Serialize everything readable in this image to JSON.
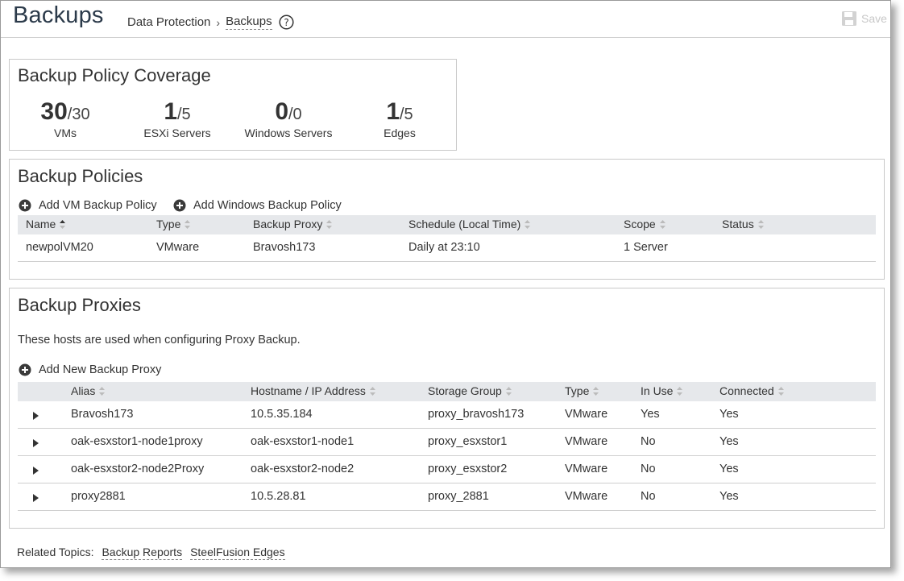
{
  "header": {
    "title": "Backups",
    "breadcrumb": [
      "Data Protection",
      "Backups"
    ],
    "save_label": "Save"
  },
  "coverage": {
    "title": "Backup Policy Coverage",
    "items": [
      {
        "count": "30",
        "total": "/30",
        "label": "VMs"
      },
      {
        "count": "1",
        "total": "/5",
        "label": "ESXi Servers"
      },
      {
        "count": "0",
        "total": "/0",
        "label": "Windows Servers"
      },
      {
        "count": "1",
        "total": "/5",
        "label": "Edges"
      }
    ]
  },
  "policies": {
    "title": "Backup Policies",
    "add_vm_label": "Add VM Backup Policy",
    "add_windows_label": "Add Windows Backup Policy",
    "columns": [
      "Name",
      "Type",
      "Backup Proxy",
      "Schedule (Local Time)",
      "Scope",
      "Status"
    ],
    "rows": [
      {
        "name": "newpolVM20",
        "type": "VMware",
        "proxy": "Bravosh173",
        "schedule": "Daily at 23:10",
        "scope": "1 Server",
        "status": ""
      }
    ]
  },
  "proxies": {
    "title": "Backup Proxies",
    "description": "These hosts are used when configuring Proxy Backup.",
    "add_label": "Add New Backup Proxy",
    "columns": [
      "Alias",
      "Hostname / IP Address",
      "Storage Group",
      "Type",
      "In Use",
      "Connected"
    ],
    "rows": [
      {
        "alias": "Bravosh173",
        "host": "10.5.35.184",
        "storage": "proxy_bravosh173",
        "type": "VMware",
        "in_use": "Yes",
        "connected": "Yes"
      },
      {
        "alias": "oak-esxstor1-node1proxy",
        "host": "oak-esxstor1-node1",
        "storage": "proxy_esxstor1",
        "type": "VMware",
        "in_use": "No",
        "connected": "Yes"
      },
      {
        "alias": "oak-esxstor2-node2Proxy",
        "host": "oak-esxstor2-node2",
        "storage": "proxy_esxstor2",
        "type": "VMware",
        "in_use": "No",
        "connected": "Yes"
      },
      {
        "alias": "proxy2881",
        "host": "10.5.28.81",
        "storage": "proxy_2881",
        "type": "VMware",
        "in_use": "No",
        "connected": "Yes"
      }
    ]
  },
  "related": {
    "label": "Related Topics:",
    "links": [
      "Backup Reports",
      "SteelFusion Edges"
    ]
  }
}
